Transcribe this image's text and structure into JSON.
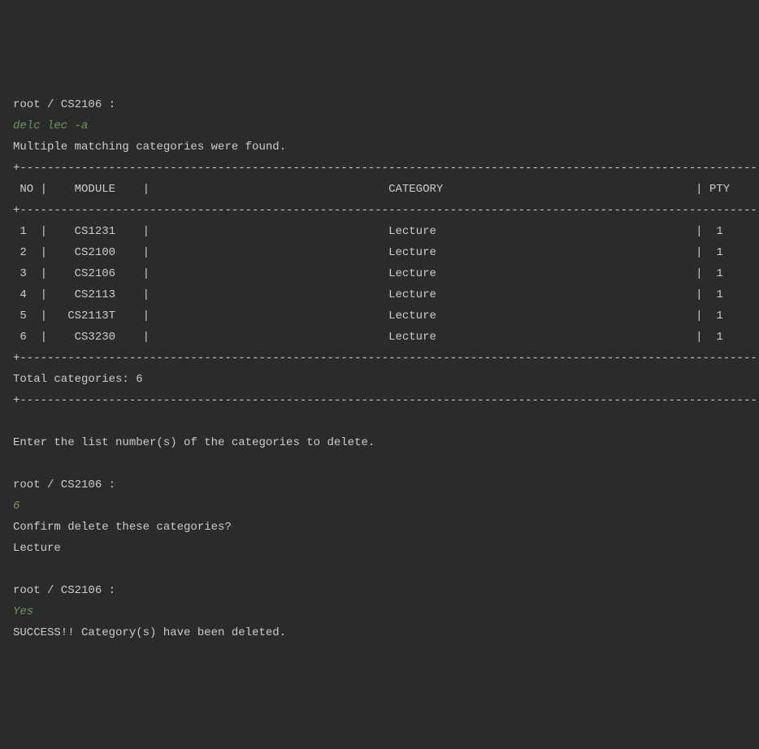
{
  "prompt1": "root / CS2106 :",
  "command1": "delc lec -a",
  "message1": "Multiple matching categories were found.",
  "border_top": "+---------------------------------------------------------------------------------------------------------------+",
  "table_header": " NO |    MODULE    |                                   CATEGORY                                     | PTY ",
  "border_mid": "+---------------------------------------------------------------------------------------------------------------+",
  "rows": [
    " 1  |    CS1231    |                                   Lecture                                      |  1  ",
    " 2  |    CS2100    |                                   Lecture                                      |  1  ",
    " 3  |    CS2106    |                                   Lecture                                      |  1  ",
    " 4  |    CS2113    |                                   Lecture                                      |  1  ",
    " 5  |   CS2113T    |                                   Lecture                                      |  1  ",
    " 6  |    CS3230    |                                   Lecture                                      |  1  "
  ],
  "border_bot": "+---------------------------------------------------------------------------------------------------------------+",
  "total_line": "Total categories: 6",
  "border_end": "+---------------------------------------------------------------------------------------------------------------+",
  "message2": "Enter the list number(s) of the categories to delete.",
  "prompt2": "root / CS2106 :",
  "command2": "6",
  "confirm_msg": "Confirm delete these categories?",
  "confirm_item": "Lecture",
  "prompt3": "root / CS2106 :",
  "command3": "Yes",
  "success_msg": "SUCCESS!! Category(s) have been deleted."
}
